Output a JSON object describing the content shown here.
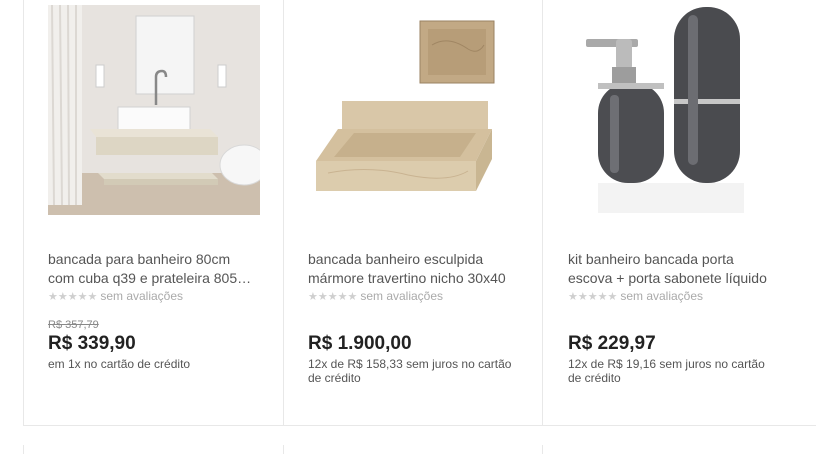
{
  "products": [
    {
      "title_line1": "bancada para banheiro 80cm",
      "title_line2": "com cuba q39 e prateleira 805…",
      "stars": "★★★★★",
      "rating_text": "sem avaliações",
      "old_price": "R$ 357,79",
      "price": "R$ 339,90",
      "installments": "em 1x no cartão de crédito"
    },
    {
      "title_line1": "bancada banheiro esculpida",
      "title_line2": "mármore travertino nicho 30x40",
      "stars": "★★★★★",
      "rating_text": "sem avaliações",
      "price": "R$ 1.900,00",
      "installments": "12x de R$ 158,33 sem juros no cartão de crédito"
    },
    {
      "title_line1": "kit banheiro bancada porta",
      "title_line2": "escova + porta sabonete líquido",
      "stars": "★★★★★",
      "rating_text": "sem avaliações",
      "price": "R$ 229,97",
      "installments": "12x de R$ 19,16 sem juros no cartão de crédito"
    }
  ]
}
